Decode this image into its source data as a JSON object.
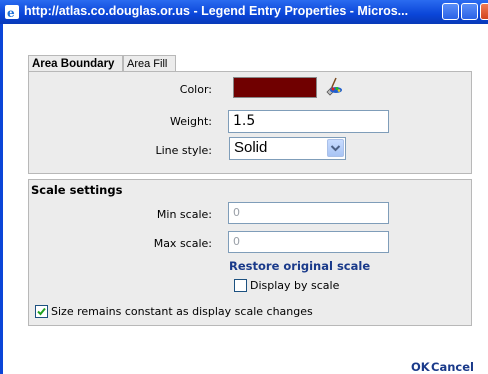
{
  "window": {
    "title": "http://atlas.co.douglas.or.us - Legend Entry Properties - Micros...",
    "accent_color": "#0a45d8"
  },
  "tabs": [
    {
      "label": "Area Boundary",
      "active": true
    },
    {
      "label": "Area Fill",
      "active": false
    }
  ],
  "boundary": {
    "color_label": "Color:",
    "color_value": "#700000",
    "weight_label": "Weight:",
    "weight_value": "1.5",
    "line_style_label": "Line style:",
    "line_style_value": "Solid"
  },
  "scale": {
    "title": "Scale settings",
    "min_label": "Min scale:",
    "min_value": "0",
    "max_label": "Max scale:",
    "max_value": "0",
    "restore_link": "Restore original scale",
    "display_by_scale_label": "Display by scale",
    "display_by_scale_checked": false,
    "size_constant_label": "Size remains constant as display scale changes",
    "size_constant_checked": true
  },
  "footer": {
    "ok_label": "OK",
    "cancel_label": "Cancel"
  }
}
